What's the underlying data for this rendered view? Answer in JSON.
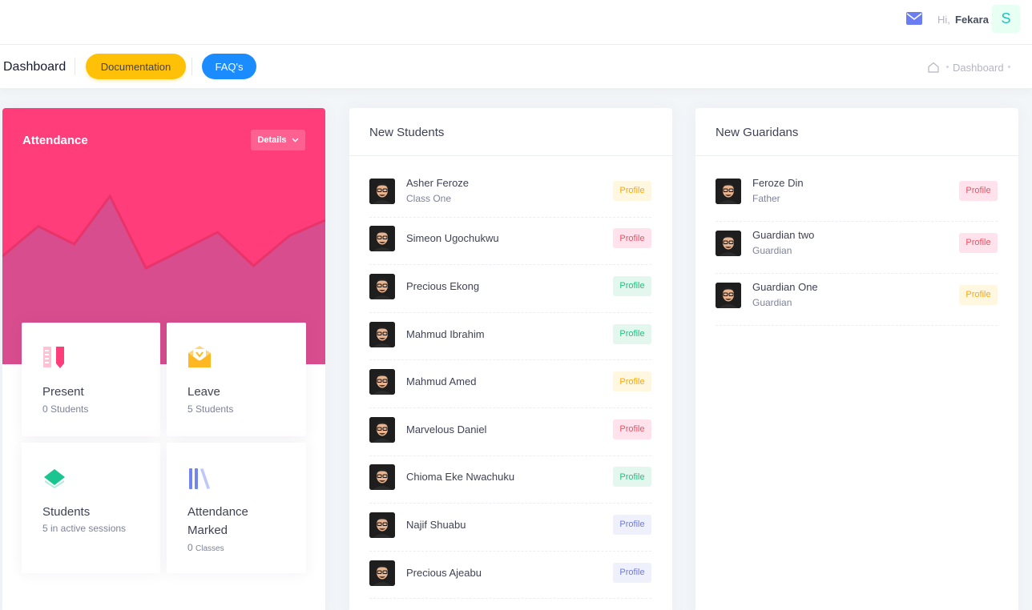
{
  "header": {
    "greeting": "Hi,",
    "user_name": "Fekara",
    "avatar_letter": "S"
  },
  "subheader": {
    "title": "Dashboard",
    "documentation_label": "Documentation",
    "faq_label": "FAQ's",
    "breadcrumb": "Dashboard"
  },
  "attendance": {
    "title": "Attendance",
    "details_label": "Details",
    "chart_data": {
      "type": "area",
      "values": [
        30,
        55,
        40,
        80,
        20,
        35,
        50,
        22,
        47,
        60
      ],
      "ylim": [
        0,
        100
      ]
    },
    "stats": [
      {
        "label": "Present",
        "sub": "0 Students"
      },
      {
        "label": "Leave",
        "sub": "5 Students"
      },
      {
        "label": "Students",
        "sub": "5 in active sessions"
      },
      {
        "label": "Attendance Marked",
        "sub_count": "0",
        "sub_unit": "Classes"
      }
    ]
  },
  "new_students": {
    "title": "New Students",
    "items": [
      {
        "name": "Asher Feroze",
        "sub": "Class One",
        "badge": "Profile",
        "badge_style": "warn"
      },
      {
        "name": "Simeon Ugochukwu",
        "badge": "Profile",
        "badge_style": "danger"
      },
      {
        "name": "Precious Ekong",
        "badge": "Profile",
        "badge_style": "success"
      },
      {
        "name": "Mahmud Ibrahim",
        "badge": "Profile",
        "badge_style": "success"
      },
      {
        "name": "Mahmud Amed",
        "badge": "Profile",
        "badge_style": "warn"
      },
      {
        "name": "Marvelous Daniel",
        "badge": "Profile",
        "badge_style": "danger"
      },
      {
        "name": "Chioma Eke Nwachuku",
        "badge": "Profile",
        "badge_style": "success"
      },
      {
        "name": "Najif Shuabu",
        "badge": "Profile",
        "badge_style": "primary"
      },
      {
        "name": "Precious Ajeabu",
        "badge": "Profile",
        "badge_style": "primary"
      }
    ]
  },
  "new_guardians": {
    "title": "New Guaridans",
    "items": [
      {
        "name": "Feroze Din",
        "sub": "Father",
        "badge": "Profile",
        "badge_style": "danger"
      },
      {
        "name": "Guardian two",
        "sub": "Guardian",
        "badge": "Profile",
        "badge_style": "danger"
      },
      {
        "name": "Guardian One",
        "sub": "Guardian",
        "badge": "Profile",
        "badge_style": "warn"
      }
    ]
  },
  "colors": {
    "attendance_bg": "#ff3d7a",
    "documentation_btn": "#ffc107",
    "faq_btn": "#1a8cff",
    "mail_icon": "#6b7df2"
  }
}
